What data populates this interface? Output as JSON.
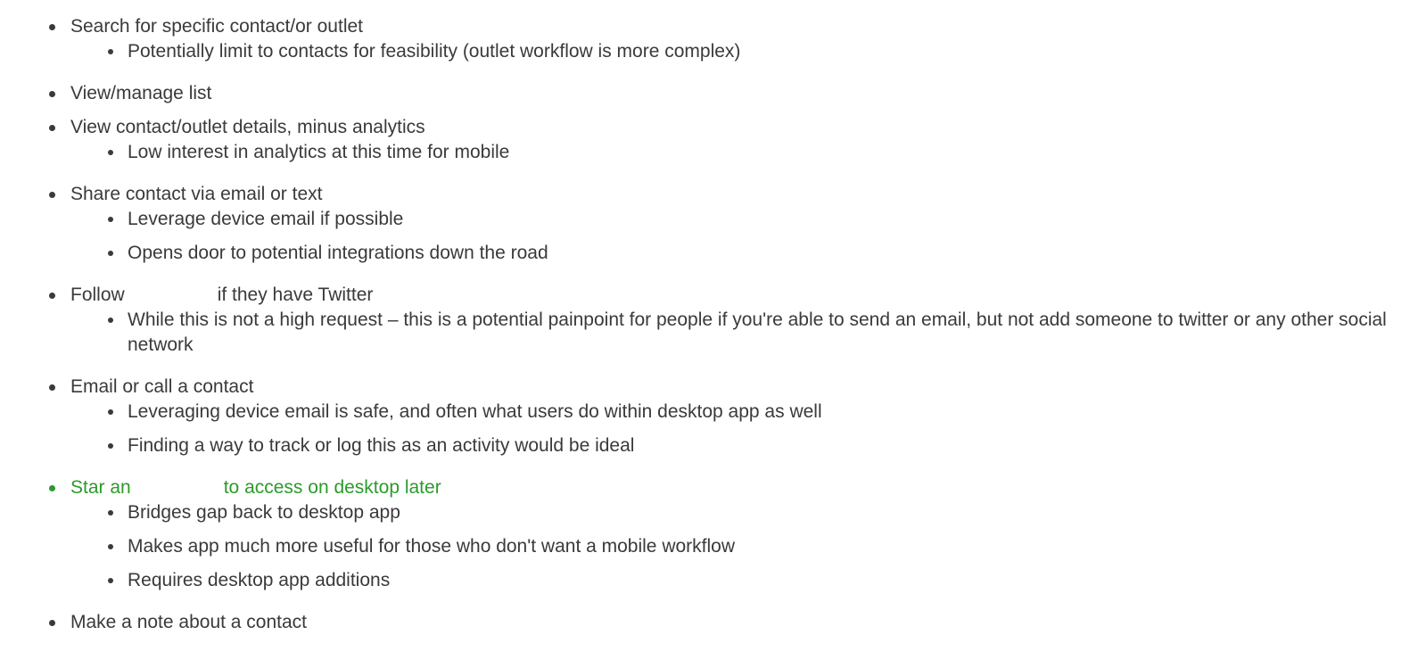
{
  "items": [
    {
      "text": "Search for specific contact/or outlet",
      "subitems": [
        "Potentially limit to contacts for feasibility (outlet workflow is more complex)"
      ]
    },
    {
      "text": "View/manage list",
      "subitems": []
    },
    {
      "text": "View contact/outlet details, minus analytics",
      "subitems": [
        "Low interest in analytics at this time for mobile"
      ]
    },
    {
      "text": "Share contact via email or text",
      "subitems": [
        "Leverage device email if possible",
        "Opens door to potential integrations down the road"
      ]
    },
    {
      "text_before": "Follow",
      "text_after": "if they have Twitter",
      "subitems": [
        "While this is not a high request – this is a potential painpoint for people if you're able to send an email, but not add someone to twitter or any other social network"
      ]
    },
    {
      "text": "Email or call a contact",
      "subitems": [
        "Leveraging device email is safe, and often what users do within desktop app as well",
        "Finding a way to track or log this as an activity would be ideal"
      ]
    },
    {
      "text_before": "Star an",
      "text_after": "to access on desktop later",
      "color": "#2c9a2c",
      "subitems": [
        "Bridges gap back to desktop app",
        "Makes app much more useful for those who don't want a mobile workflow",
        "Requires desktop app additions"
      ]
    },
    {
      "text": "Make a note about a contact",
      "subitems": []
    }
  ]
}
